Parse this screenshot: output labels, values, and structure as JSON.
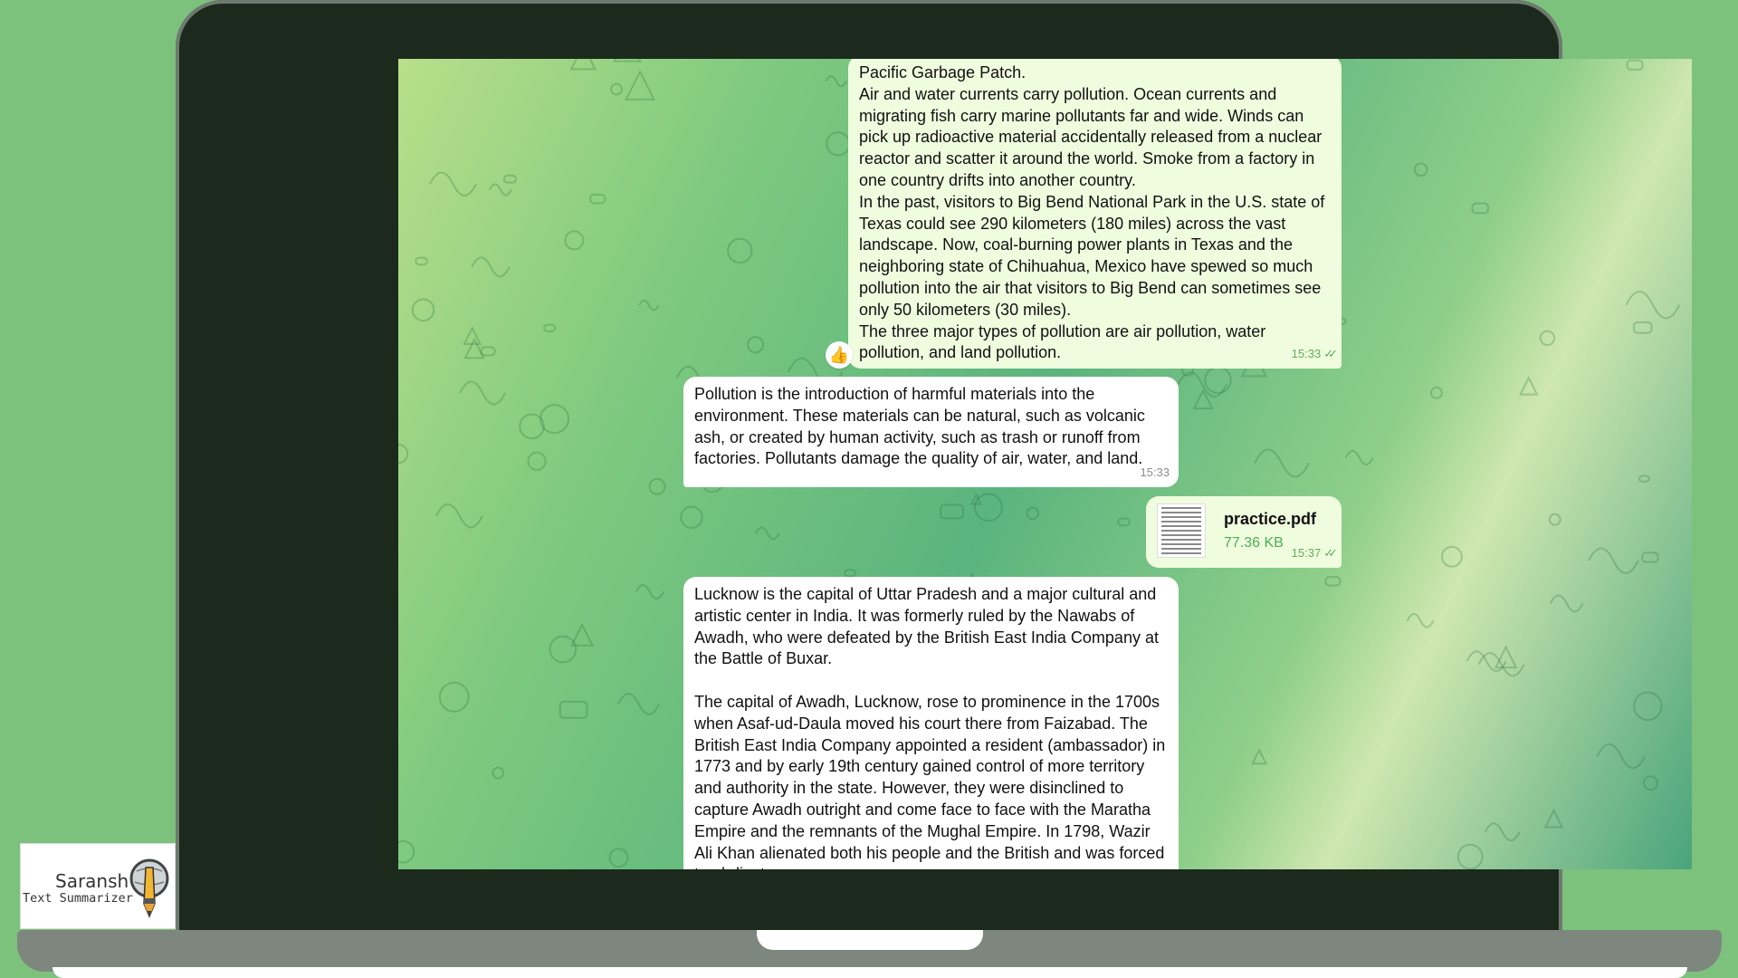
{
  "messages": [
    {
      "paragraphs": [
        "Pacific Garbage Patch.",
        "Air and water currents carry pollution. Ocean currents and migrating fish carry marine pollutants far and wide. Winds can pick up radioactive material accidentally released from a nuclear reactor and scatter it around the world. Smoke from a factory in one country drifts into another country.",
        "In the past, visitors to Big Bend National Park in the U.S. state of Texas could see 290 kilometers (180 miles) across the vast landscape. Now, coal-burning power plants in Texas and the neighboring state of Chihuahua, Mexico have spewed so much pollution into the air that visitors to Big Bend can sometimes see only 50 kilometers (30 miles).",
        "The three major types of pollution are air pollution, water pollution, and land pollution."
      ],
      "time": "15:33",
      "reaction": "👍"
    },
    {
      "text": "Pollution is the introduction of harmful materials into the environment. These materials can be natural, such as volcanic ash, or created by human activity, such as trash or runoff from factories. Pollutants damage the quality of air, water, and land.",
      "time": "15:33"
    },
    {
      "file_name": "practice.pdf",
      "file_size": "77.36 KB",
      "time": "15:37"
    },
    {
      "paragraphs": [
        "Lucknow is the capital of Uttar Pradesh and a major cultural and artistic center in India. It was formerly ruled by the Nawabs of Awadh, who were defeated by the British East India Company at the Battle of Buxar.",
        "The capital of Awadh, Lucknow, rose to prominence in the 1700s when Asaf-ud-Daula moved his court there from Faizabad. The British East India Company appointed a resident (ambassador) in 1773 and by early 19th century gained control of more territory and authority in the state. However, they were disinclined to capture Awadh outright and come face to face with the Maratha Empire and the remnants of the Mughal Empire. In 1798, Wazir Ali Khan alienated both his people and the British and was forced to abdicate."
      ]
    }
  ],
  "logo": {
    "title": "Saransh",
    "subtitle": "Text Summarizer"
  },
  "icons": {
    "double_check": "double-check-icon",
    "thumbs_up": "thumbs-up-icon",
    "pdf": "pdf-file-icon"
  }
}
